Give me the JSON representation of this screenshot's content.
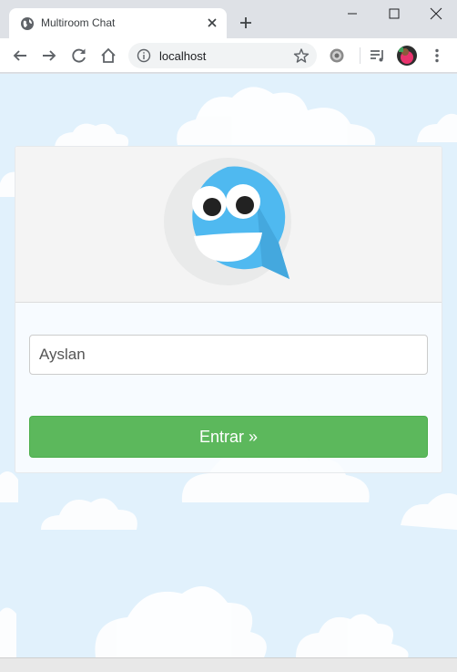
{
  "browser": {
    "tab": {
      "title": "Multiroom Chat"
    },
    "address": {
      "url": "localhost"
    }
  },
  "page": {
    "login": {
      "name_value": "Ayslan",
      "enter_label": "Entrar »"
    }
  },
  "colors": {
    "page_background": "#e1f1fc",
    "button_green": "#5cb85c",
    "logo_blue": "#4fb9f0"
  }
}
